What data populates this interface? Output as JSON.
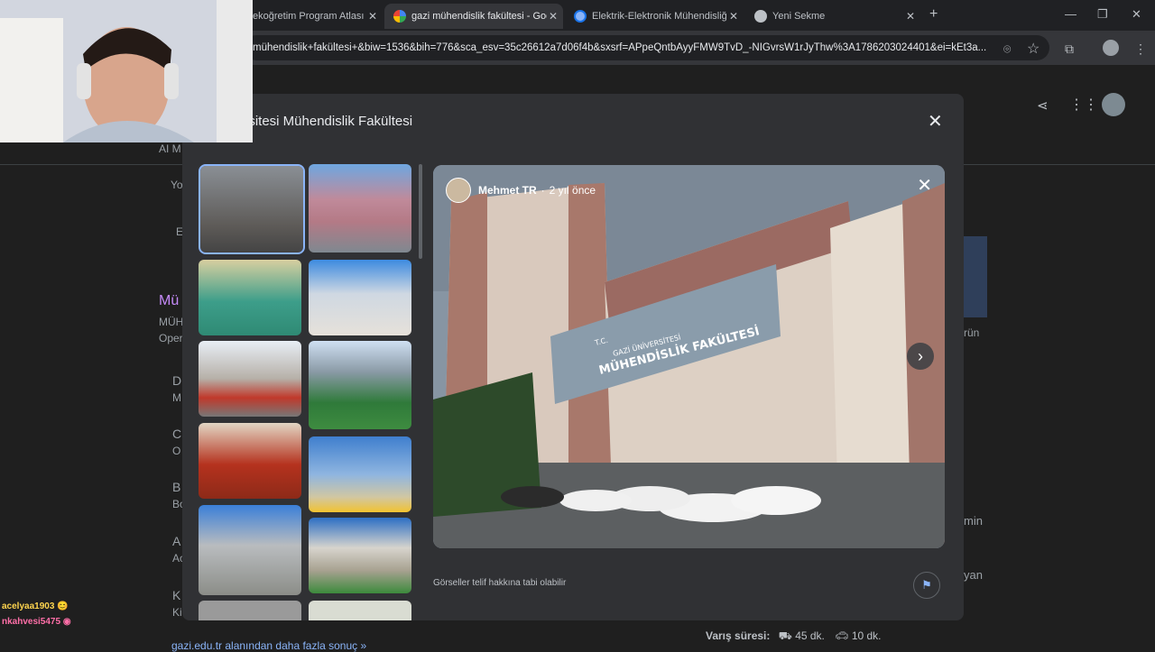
{
  "browser": {
    "tabs": [
      {
        "label": "ekoğretim Program Atlası"
      },
      {
        "label": "gazi mühendislik fakültesi - Goo"
      },
      {
        "label": "Elektrik-Elektronik Mühendisliği"
      },
      {
        "label": "Yeni Sekme"
      }
    ],
    "url": "mühendislik+fakültesi+&biw=1536&bih=776&sca_esv=35c26612a7d06f4b&sxsrf=APpeQntbAyyFMW9TvD_-NIGvrsW1rJyThw%3A1786203024401&ei=kEt3a..."
  },
  "background": {
    "snippets": [
      "AI M",
      "Yo",
      "E",
      "Mü",
      "MÜH",
      "Oper",
      "D",
      "M",
      "C",
      "O",
      "B",
      "Bo",
      "A",
      "Ac",
      "K",
      "Ki"
    ],
    "right_snippets": [
      "rün",
      "min",
      "yan"
    ],
    "travel": {
      "label": "Varış süresi:",
      "walk": "45 dk.",
      "car": "10 dk."
    },
    "more_results": "gazi.edu.tr alanından daha fazla sonuç »"
  },
  "dialog": {
    "title": "ersitesi Mühendislik Fakültesi",
    "viewer": {
      "author": "Mehmet TR",
      "time": "2 yıl önce",
      "sign_line1": "T.C.",
      "sign_line2": "GAZİ ÜNİVERSİTESİ",
      "sign_line3": "MÜHENDİSLİK FAKÜLTESİ"
    },
    "copyright": "Görseller telif hakkına tabi olabilir"
  },
  "chat": [
    {
      "user": "acelyaa1903"
    },
    {
      "user": "nkahvesi5475"
    }
  ],
  "colors": {
    "accent": "#8ab4f8",
    "dialog_bg": "#303134",
    "page_bg": "#1f1f1f"
  }
}
